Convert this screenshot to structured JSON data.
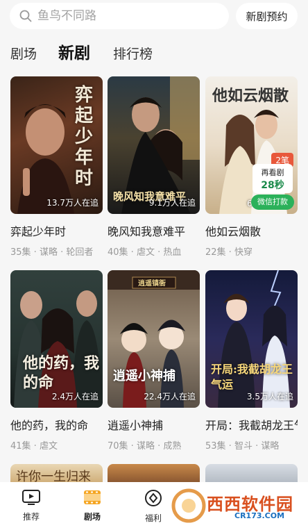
{
  "search": {
    "placeholder": "鱼鸟不同路"
  },
  "new_drama_button": "新剧预约",
  "tabs": [
    {
      "label": "剧场"
    },
    {
      "label": "新剧"
    },
    {
      "label": "排行榜"
    }
  ],
  "cards": [
    {
      "title": "弈起少年时",
      "tags": "35集 · 谋略 · 轮回者",
      "views": "13.7万人在追",
      "poster_text": "弈起少年时"
    },
    {
      "title": "晚风知我意难平",
      "tags": "40集 · 虐文 · 热血",
      "views": "9.1万人在追",
      "poster_text": "晚风知我意难平"
    },
    {
      "title": "他如云烟散",
      "tags": "22集 · 快穿",
      "views": "6",
      "poster_text": "他如云烟散"
    },
    {
      "title": "他的药，我的命",
      "tags": "41集 · 虐文",
      "views": "2.4万人在追",
      "poster_text": "他的药，我的命"
    },
    {
      "title": "逍遥小神捕",
      "tags": "70集 · 谋略 · 成熟",
      "views": "22.4万人在追",
      "poster_text": "逍遥小神捕",
      "sign": "逍遥镇衙"
    },
    {
      "title": "开局：我截胡龙王气运",
      "tags": "53集 · 智斗 · 谋略",
      "views": "3.5万人在追",
      "poster_text": "开局:我截胡龙王气运"
    }
  ],
  "promo": {
    "badge": "2笔",
    "line1": "再看剧",
    "line2": "28秒",
    "button": "微信打款"
  },
  "partial_row": {
    "first_poster_text": "许你一生归来"
  },
  "bottom_nav": [
    {
      "label": "推荐",
      "icon": "tv-icon"
    },
    {
      "label": "剧场",
      "icon": "film-icon"
    },
    {
      "label": "福利",
      "icon": "coin-icon"
    }
  ],
  "watermark": {
    "main": "西西软件园",
    "sub": "CR173.COM"
  },
  "colors": {
    "accent": "#f5a623",
    "promo_green": "#2bb15a",
    "badge_red": "#e8583b"
  }
}
